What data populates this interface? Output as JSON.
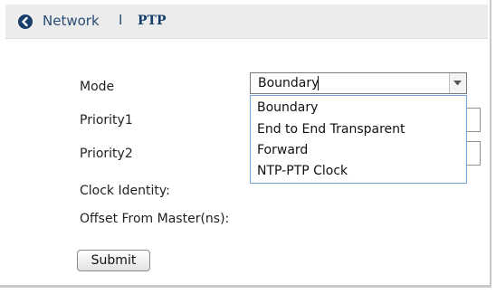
{
  "breadcrumb": {
    "back_icon": "chevron-left-circle-icon",
    "parent": "Network",
    "separator": "I",
    "current": "PTP"
  },
  "form": {
    "mode_label": "Mode",
    "mode_value": "Boundary",
    "mode_options": [
      "Boundary",
      "End to End Transparent",
      "Forward",
      "NTP-PTP Clock"
    ],
    "priority1_label": "Priority1",
    "priority2_label": "Priority2",
    "clock_identity_label": "Clock Identity:",
    "offset_label": "Offset From Master(ns):",
    "submit_label": "Submit"
  },
  "colors": {
    "header_bg": "#ececec",
    "breadcrumb_text": "#2a4d73",
    "back_icon_bg": "#163f6b",
    "dropdown_border": "#6fa8dc"
  }
}
